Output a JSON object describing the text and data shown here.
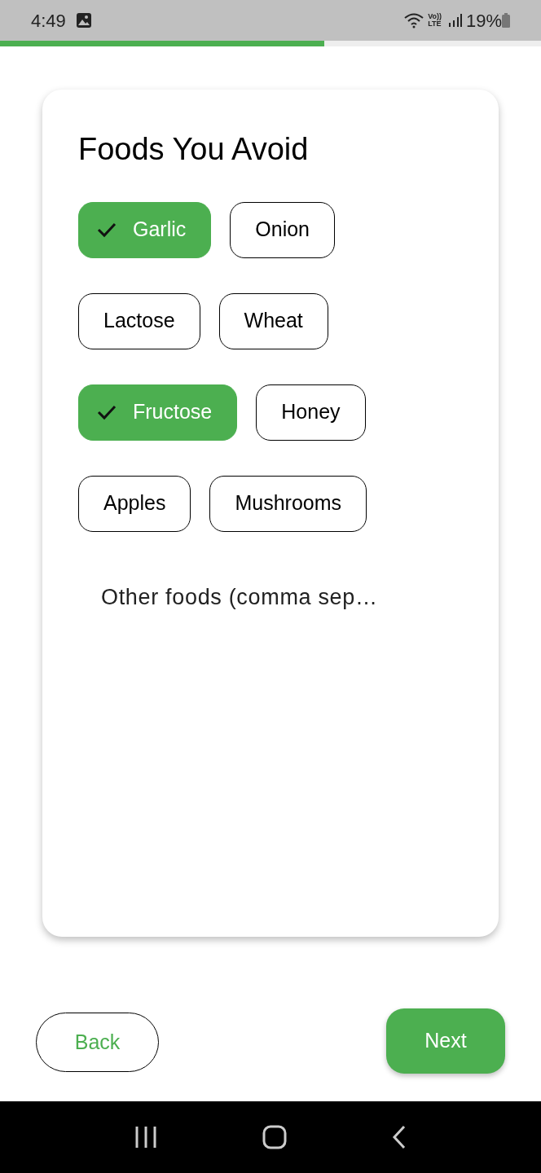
{
  "status_bar": {
    "time": "4:49",
    "volte_top": "Vo))",
    "volte_bottom": "LTE",
    "battery": "19%"
  },
  "progress": {
    "level": 0.6
  },
  "card": {
    "title": "Foods You Avoid",
    "chips": [
      {
        "label": "Garlic",
        "selected": true
      },
      {
        "label": "Onion",
        "selected": false
      },
      {
        "label": "Lactose",
        "selected": false
      },
      {
        "label": "Wheat",
        "selected": false
      },
      {
        "label": "Fructose",
        "selected": true
      },
      {
        "label": "Honey",
        "selected": false
      },
      {
        "label": "Apples",
        "selected": false
      },
      {
        "label": "Mushrooms",
        "selected": false
      }
    ],
    "other_field": {
      "placeholder": "Other foods (comma sep…"
    }
  },
  "buttons": {
    "back": "Back",
    "next": "Next"
  }
}
